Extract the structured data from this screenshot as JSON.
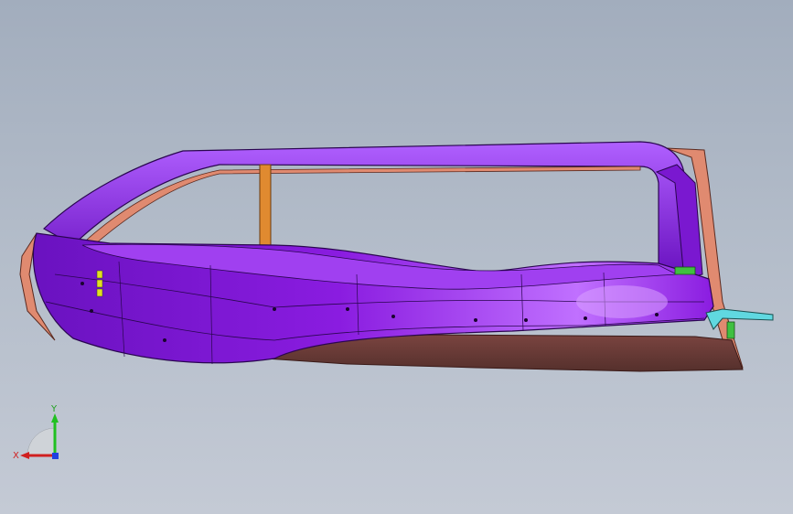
{
  "viewport": {
    "background_top": "#a2adbd",
    "background_bottom": "#c4cad5"
  },
  "model": {
    "part_color_primary": "#8a1ce0",
    "part_color_highlight": "#c070ff",
    "part_color_dark": "#4a0a90",
    "flange_color": "#e08a70",
    "bottom_panel_color": "#6b3a36",
    "pillar_color": "#e08a30",
    "clip_color": "#60d8e0",
    "bracket_color": "#40c040",
    "marker_color": "#e0e020"
  },
  "triad": {
    "x_label": "X",
    "y_label": "Y",
    "x_color": "#d02020",
    "y_color": "#20c020",
    "z_color": "#2040e0",
    "icon": "coordinate-triad-icon"
  }
}
